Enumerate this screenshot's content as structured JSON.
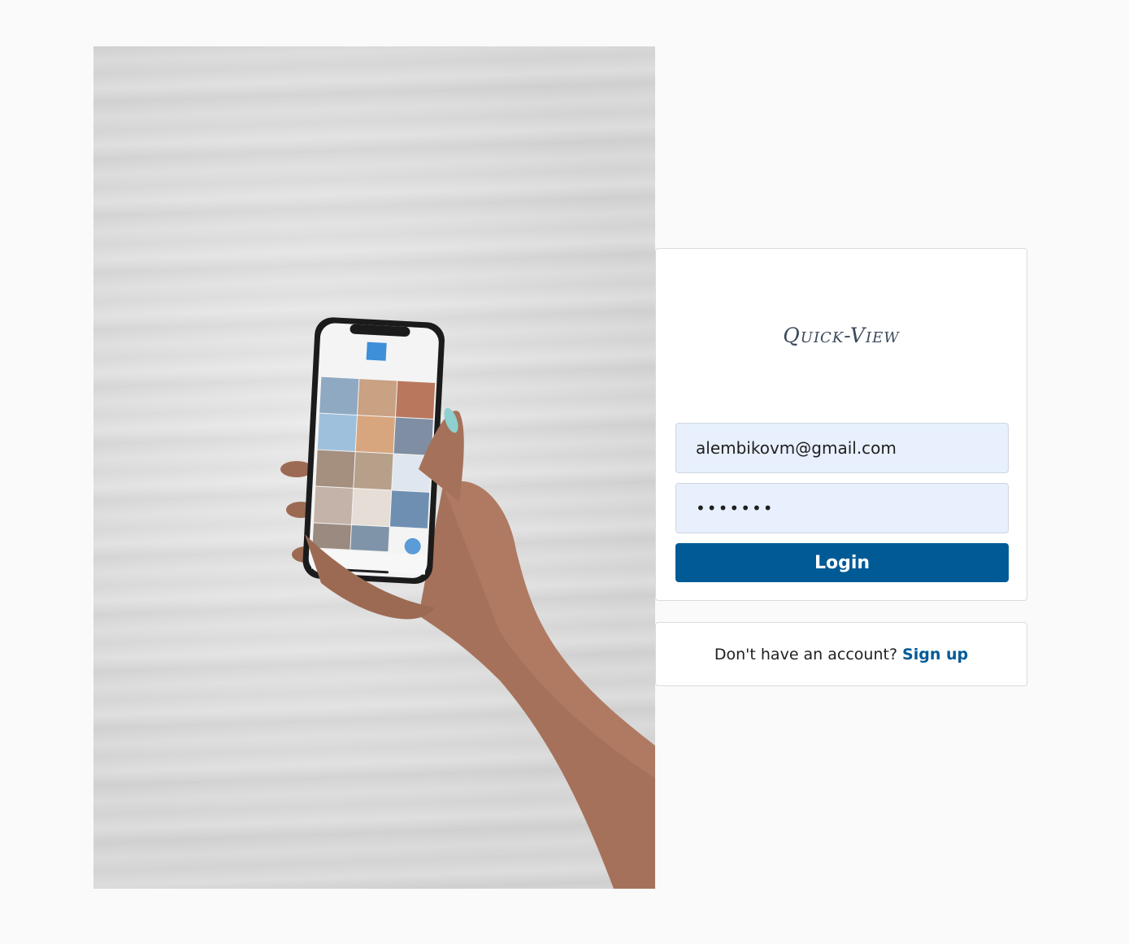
{
  "brand": {
    "logo_text": "Quick-View"
  },
  "login_form": {
    "email_value": "alembikovm@gmail.com",
    "password_value": "•••••••",
    "login_label": "Login"
  },
  "signup_prompt": {
    "text": "Don't have an account?",
    "link_label": "Sign up"
  },
  "colors": {
    "accent": "#005a96",
    "input_background": "#e8f0fe",
    "page_background": "#fafafa"
  }
}
